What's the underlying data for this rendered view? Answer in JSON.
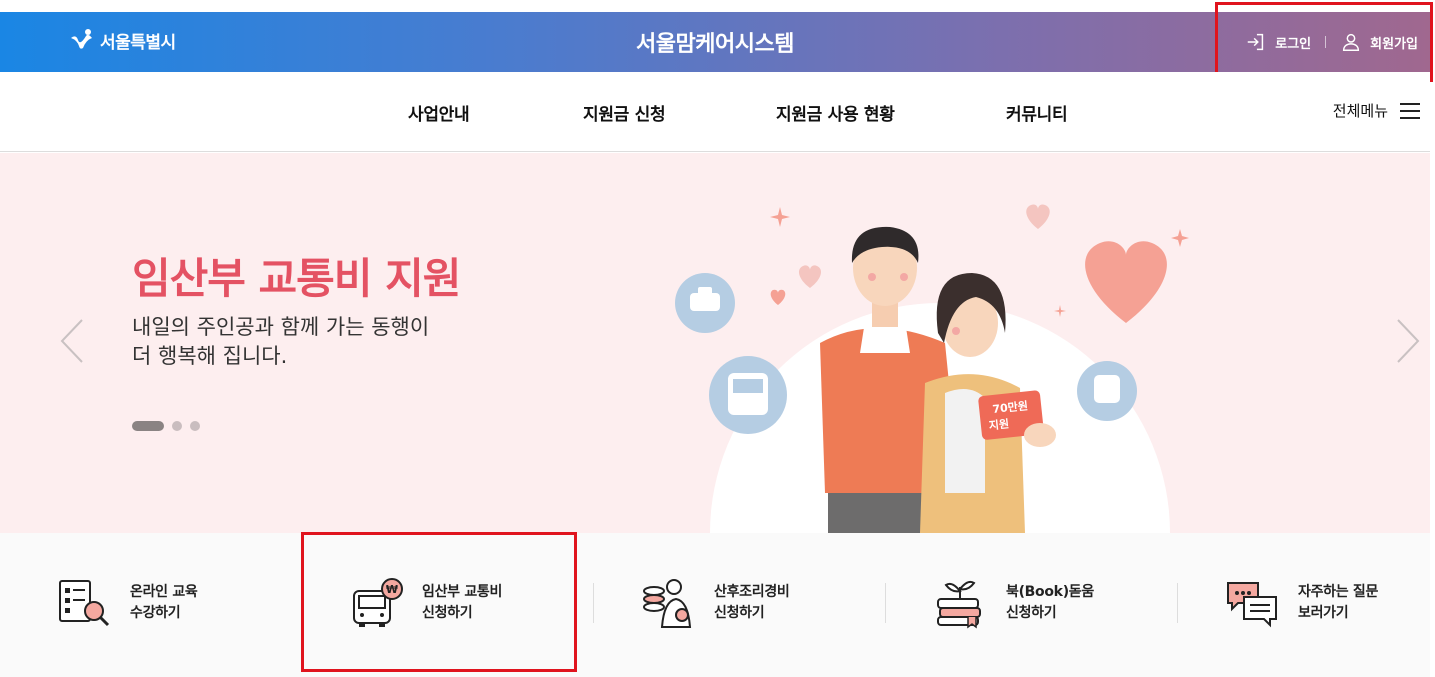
{
  "header": {
    "logo_text": "서울특별시",
    "site_title": "서울맘케어시스템",
    "login_label": "로그인",
    "signup_label": "회원가입"
  },
  "gnb": {
    "items": [
      "사업안내",
      "지원금 신청",
      "지원금 사용 현황",
      "커뮤니티"
    ],
    "all_menu_label": "전체메뉴"
  },
  "hero": {
    "title": "임산부 교통비 지원",
    "subtitle_line1": "내일의 주인공과 함께 가는 동행이",
    "subtitle_line2": "더 행복해 집니다.",
    "card_line1": "70만원",
    "card_line2": "지원",
    "slide_count": 3,
    "active_slide": 1
  },
  "quick_menu": [
    {
      "line1": "온라인 교육",
      "line2": "수강하기",
      "icon": "document-search-icon"
    },
    {
      "line1": "임산부 교통비",
      "line2": "신청하기",
      "icon": "bus-won-icon"
    },
    {
      "line1": "산후조리경비",
      "line2": "신청하기",
      "icon": "mother-coins-icon"
    },
    {
      "line1": "북(Book)돋움",
      "line2": "신청하기",
      "icon": "books-sprout-icon"
    },
    {
      "line1": "자주하는 질문",
      "line2": "보러가기",
      "icon": "chat-bubbles-icon"
    }
  ],
  "colors": {
    "topbar_start": "#1a86e4",
    "topbar_end": "#a0688f",
    "hero_bg": "#fdeeef",
    "hero_title": "#e45263",
    "highlight": "#e0141e"
  }
}
